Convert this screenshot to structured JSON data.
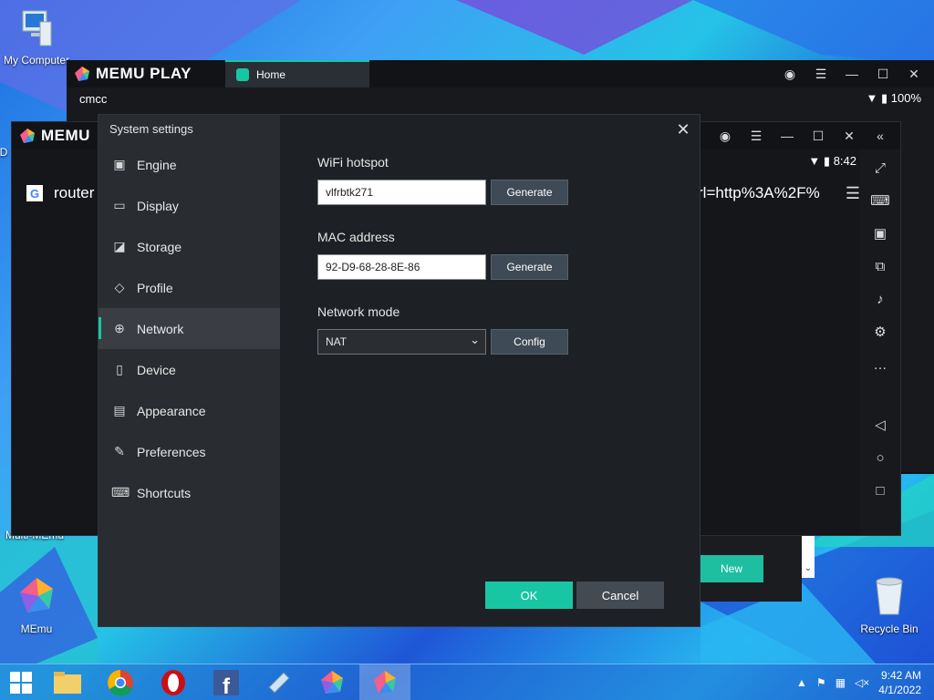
{
  "desktop": {
    "icons": [
      {
        "label": "My Computer"
      },
      {
        "label": "D"
      },
      {
        "label": "MEmu"
      },
      {
        "label": "Recycle Bin"
      }
    ],
    "multi_label": "Multi-MEmu"
  },
  "back_window": {
    "brand": "MEMU PLAY",
    "tab_label": "Home",
    "carrier": "cmcc",
    "battery": "100%"
  },
  "mid_window": {
    "brand": "MEMU",
    "clock": "8:42",
    "url_start": "router",
    "url_end": "rl=http%3A%2F%",
    "google_glyph": "G"
  },
  "multi_memu": {
    "new_label": "New"
  },
  "dialog": {
    "title": "System settings",
    "nav": [
      {
        "label": "Engine",
        "icon": "chip-icon"
      },
      {
        "label": "Display",
        "icon": "monitor-icon"
      },
      {
        "label": "Storage",
        "icon": "disk-icon"
      },
      {
        "label": "Profile",
        "icon": "tag-icon"
      },
      {
        "label": "Network",
        "icon": "globe-icon"
      },
      {
        "label": "Device",
        "icon": "phone-icon"
      },
      {
        "label": "Appearance",
        "icon": "window-icon"
      },
      {
        "label": "Preferences",
        "icon": "wrench-icon"
      },
      {
        "label": "Shortcuts",
        "icon": "keyboard-icon"
      }
    ],
    "active_nav": "Network",
    "wifi_label": "WiFi hotspot",
    "wifi_value": "vlfrbtk271",
    "mac_label": "MAC address",
    "mac_value": "92-D9-68-28-8E-86",
    "generate_label": "Generate",
    "mode_label": "Network mode",
    "mode_value": "NAT",
    "config_label": "Config",
    "ok_label": "OK",
    "cancel_label": "Cancel"
  },
  "taskbar": {
    "time": "9:42 AM",
    "date": "4/1/2022"
  },
  "colors": {
    "accent": "#19c6a3",
    "dialog_bg": "#1d2024",
    "sidebar_bg": "#292c31"
  }
}
